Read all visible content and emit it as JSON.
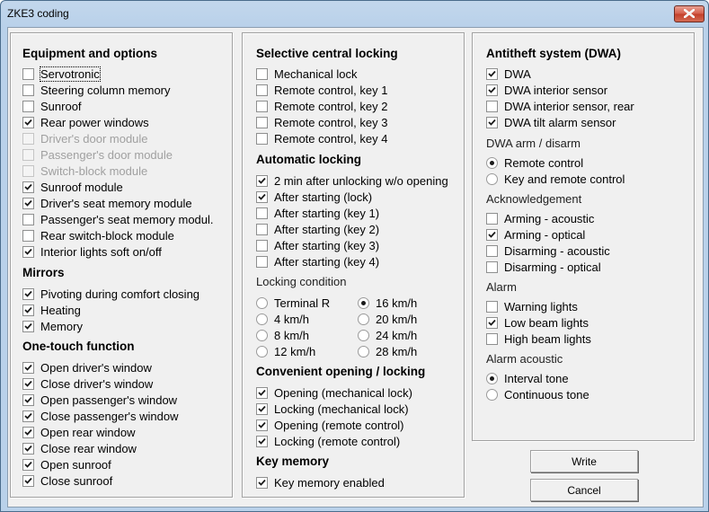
{
  "window": {
    "title": "ZKE3 coding",
    "close_icon": "close-icon"
  },
  "equipment": {
    "heading": "Equipment and options",
    "items": [
      {
        "label": "Servotronic",
        "checked": false,
        "disabled": false,
        "focused": true
      },
      {
        "label": "Steering column memory",
        "checked": false,
        "disabled": false
      },
      {
        "label": "Sunroof",
        "checked": false,
        "disabled": false
      },
      {
        "label": "Rear power windows",
        "checked": true,
        "disabled": false
      },
      {
        "label": "Driver's door module",
        "checked": false,
        "disabled": true
      },
      {
        "label": "Passenger's door module",
        "checked": false,
        "disabled": true
      },
      {
        "label": "Switch-block module",
        "checked": false,
        "disabled": true
      },
      {
        "label": "Sunroof module",
        "checked": true,
        "disabled": false
      },
      {
        "label": "Driver's seat memory module",
        "checked": true,
        "disabled": false
      },
      {
        "label": "Passenger's seat memory modul.",
        "checked": false,
        "disabled": false
      },
      {
        "label": "Rear switch-block module",
        "checked": false,
        "disabled": false
      },
      {
        "label": "Interior lights soft on/off",
        "checked": true,
        "disabled": false
      }
    ]
  },
  "mirrors": {
    "heading": "Mirrors",
    "items": [
      {
        "label": "Pivoting during comfort closing",
        "checked": true
      },
      {
        "label": "Heating",
        "checked": true
      },
      {
        "label": "Memory",
        "checked": true
      }
    ]
  },
  "onetouch": {
    "heading": "One-touch function",
    "items": [
      {
        "label": "Open driver's window",
        "checked": true
      },
      {
        "label": "Close driver's window",
        "checked": true
      },
      {
        "label": "Open passenger's window",
        "checked": true
      },
      {
        "label": "Close passenger's window",
        "checked": true
      },
      {
        "label": "Open rear window",
        "checked": true
      },
      {
        "label": "Close rear window",
        "checked": true
      },
      {
        "label": "Open sunroof",
        "checked": true
      },
      {
        "label": "Close sunroof",
        "checked": true
      }
    ]
  },
  "selective": {
    "heading": "Selective central locking",
    "items": [
      {
        "label": "Mechanical lock",
        "checked": false
      },
      {
        "label": "Remote control, key 1",
        "checked": false
      },
      {
        "label": "Remote control, key 2",
        "checked": false
      },
      {
        "label": "Remote control, key 3",
        "checked": false
      },
      {
        "label": "Remote control, key 4",
        "checked": false
      }
    ]
  },
  "autolock": {
    "heading": "Automatic locking",
    "items": [
      {
        "label": "2 min after unlocking w/o opening",
        "checked": true
      },
      {
        "label": "After starting (lock)",
        "checked": true
      },
      {
        "label": "After starting (key 1)",
        "checked": false
      },
      {
        "label": "After starting (key 2)",
        "checked": false
      },
      {
        "label": "After starting (key 3)",
        "checked": false
      },
      {
        "label": "After starting (key 4)",
        "checked": false
      }
    ]
  },
  "lockcond": {
    "label": "Locking condition",
    "options": [
      {
        "label": "Terminal R",
        "selected": false
      },
      {
        "label": "4 km/h",
        "selected": false
      },
      {
        "label": "8 km/h",
        "selected": false
      },
      {
        "label": "12 km/h",
        "selected": false
      },
      {
        "label": "16 km/h",
        "selected": true
      },
      {
        "label": "20 km/h",
        "selected": false
      },
      {
        "label": "24 km/h",
        "selected": false
      },
      {
        "label": "28 km/h",
        "selected": false
      }
    ]
  },
  "convenient": {
    "heading": "Convenient opening / locking",
    "items": [
      {
        "label": "Opening (mechanical lock)",
        "checked": true
      },
      {
        "label": "Locking (mechanical lock)",
        "checked": true
      },
      {
        "label": "Opening (remote control)",
        "checked": true
      },
      {
        "label": "Locking (remote control)",
        "checked": true
      }
    ]
  },
  "keymem": {
    "heading": "Key memory",
    "items": [
      {
        "label": "Key memory enabled",
        "checked": true
      }
    ]
  },
  "dwa": {
    "heading": "Antitheft system (DWA)",
    "items": [
      {
        "label": "DWA",
        "checked": true
      },
      {
        "label": "DWA interior sensor",
        "checked": true
      },
      {
        "label": "DWA interior sensor, rear",
        "checked": false
      },
      {
        "label": "DWA tilt alarm sensor",
        "checked": true
      }
    ]
  },
  "armdisarm": {
    "label": "DWA arm / disarm",
    "options": [
      {
        "label": "Remote control",
        "selected": true
      },
      {
        "label": "Key and remote control",
        "selected": false
      }
    ]
  },
  "ack": {
    "label": "Acknowledgement",
    "items": [
      {
        "label": "Arming - acoustic",
        "checked": false
      },
      {
        "label": "Arming - optical",
        "checked": true
      },
      {
        "label": "Disarming - acoustic",
        "checked": false
      },
      {
        "label": "Disarming - optical",
        "checked": false
      }
    ]
  },
  "alarm": {
    "label": "Alarm",
    "items": [
      {
        "label": "Warning lights",
        "checked": false
      },
      {
        "label": "Low beam lights",
        "checked": true
      },
      {
        "label": "High beam lights",
        "checked": false
      }
    ]
  },
  "alarmacoustic": {
    "label": "Alarm acoustic",
    "options": [
      {
        "label": "Interval tone",
        "selected": true
      },
      {
        "label": "Continuous tone",
        "selected": false
      }
    ]
  },
  "buttons": {
    "write": "Write",
    "cancel": "Cancel"
  }
}
